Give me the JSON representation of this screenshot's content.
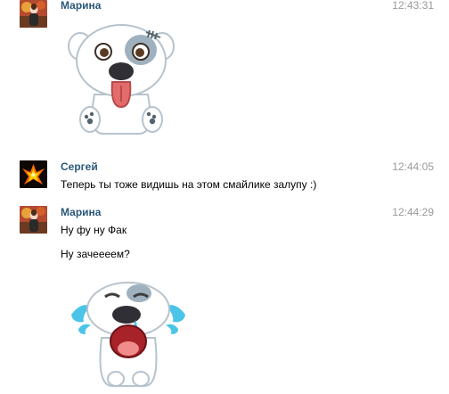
{
  "messages": [
    {
      "author": "Марина",
      "time": "12:43:31",
      "avatar": "avatar-marina",
      "sticker": "happy-dog-sticker-tongue-out"
    },
    {
      "author": "Сергей",
      "time": "12:44:05",
      "avatar": "avatar-sergey-phoenix",
      "lines": [
        "Теперь ты тоже видишь на этом смайлике залупу :)"
      ]
    },
    {
      "author": "Марина",
      "time": "12:44:29",
      "avatar": "avatar-marina",
      "lines": [
        "Ну фу ну Фак",
        "Ну зачеееем?"
      ],
      "sticker": "crying-dog-sticker"
    }
  ],
  "colors": {
    "author_link": "#2b587a",
    "timestamp": "#9a9a9a",
    "background": "#ffffff"
  }
}
